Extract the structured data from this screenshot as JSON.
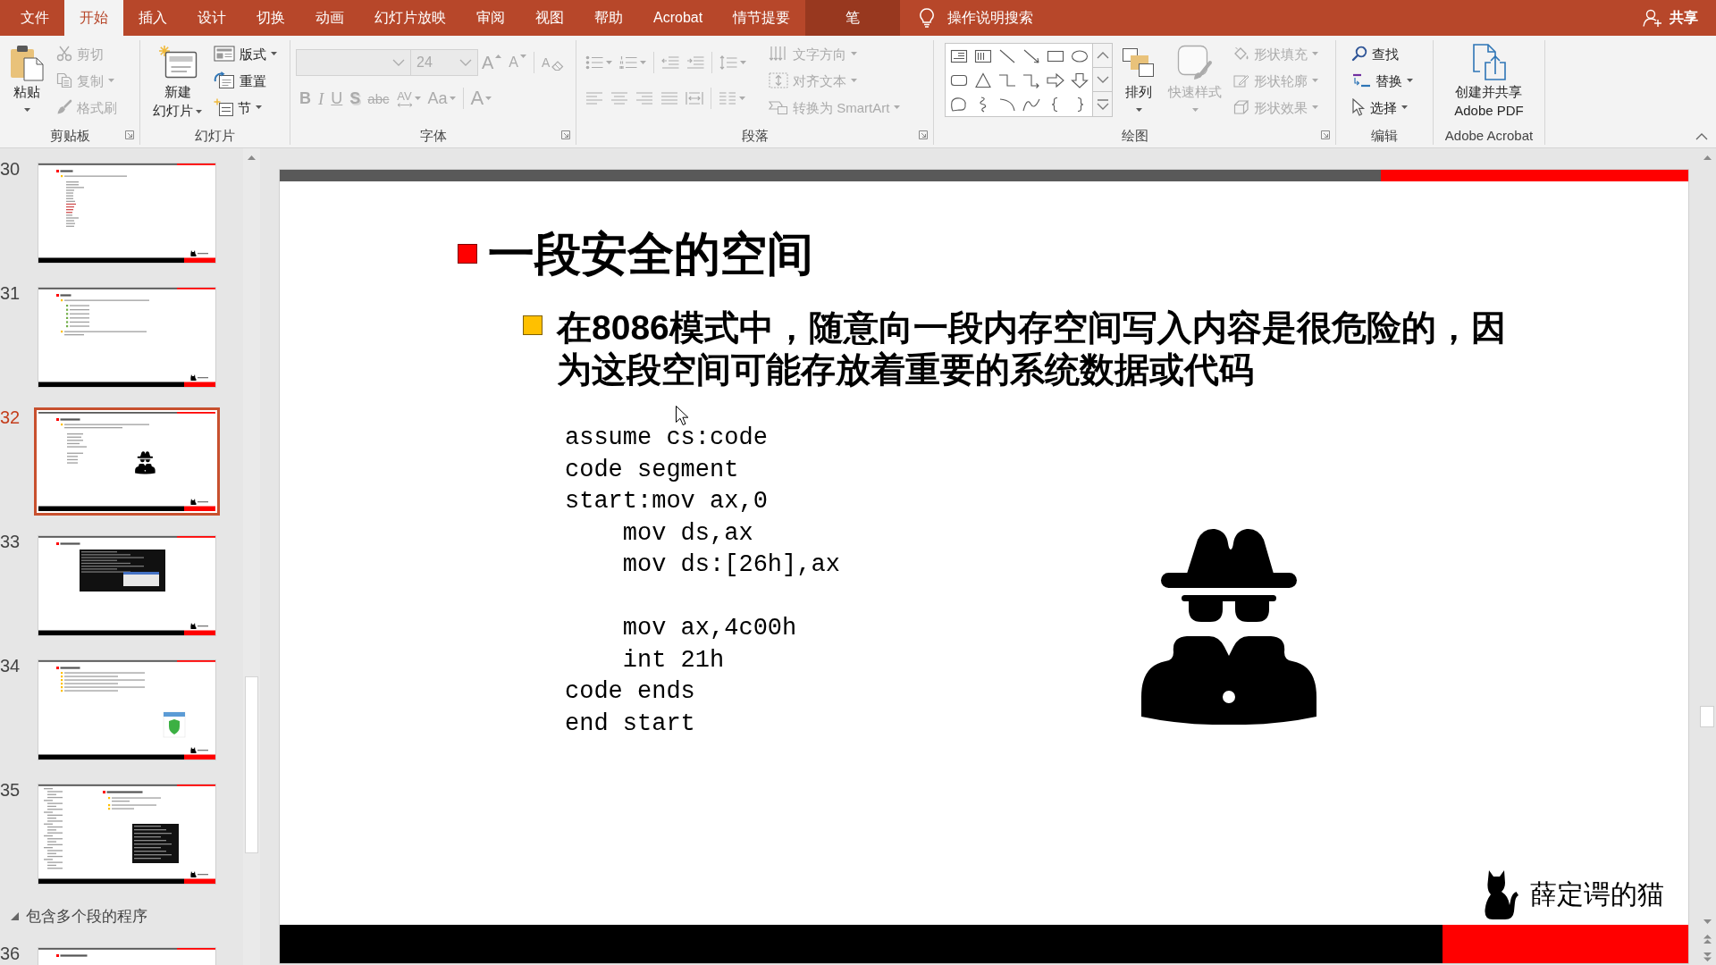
{
  "tabs": [
    {
      "label": "文件",
      "kind": "tab",
      "selected": false
    },
    {
      "label": "开始",
      "kind": "tab",
      "selected": true
    },
    {
      "label": "插入",
      "kind": "tab",
      "selected": false
    },
    {
      "label": "设计",
      "kind": "tab",
      "selected": false
    },
    {
      "label": "切换",
      "kind": "tab",
      "selected": false
    },
    {
      "label": "动画",
      "kind": "tab",
      "selected": false
    },
    {
      "label": "幻灯片放映",
      "kind": "tab",
      "selected": false
    },
    {
      "label": "审阅",
      "kind": "tab",
      "selected": false
    },
    {
      "label": "视图",
      "kind": "tab",
      "selected": false
    },
    {
      "label": "帮助",
      "kind": "tab",
      "selected": false
    },
    {
      "label": "Acrobat",
      "kind": "tab",
      "selected": false
    },
    {
      "label": "情节提要",
      "kind": "tab",
      "selected": false
    },
    {
      "label": "笔",
      "kind": "contextual",
      "selected": false
    }
  ],
  "tell_me": {
    "placeholder": "操作说明搜索"
  },
  "share": {
    "label": "共享"
  },
  "ribbon": {
    "groups": [
      {
        "label": "剪贴板",
        "launcher": true,
        "items": [
          {
            "kind": "large",
            "lines": [
              "粘贴"
            ],
            "dropdown": true,
            "disabled": false
          },
          {
            "kind": "stack",
            "items": [
              {
                "label": "剪切",
                "dropdown": false,
                "disabled": true
              },
              {
                "label": "复制",
                "dropdown": true,
                "disabled": true
              },
              {
                "label": "格式刷",
                "dropdown": false,
                "disabled": true
              }
            ]
          }
        ]
      },
      {
        "label": "幻灯片",
        "launcher": false,
        "items": [
          {
            "kind": "large",
            "lines": [
              "新建",
              "幻灯片"
            ],
            "dropdown": true,
            "disabled": false
          },
          {
            "kind": "stack",
            "items": [
              {
                "label": "版式",
                "dropdown": true,
                "disabled": false
              },
              {
                "label": "重置",
                "dropdown": false,
                "disabled": false
              },
              {
                "label": "节",
                "dropdown": true,
                "disabled": false
              }
            ]
          }
        ]
      },
      {
        "label": "字体",
        "launcher": true,
        "items": [
          {
            "kind": "rows",
            "rows": [
              [
                {
                  "kind": "fontbox",
                  "disabled": true
                },
                {
                  "kind": "sizebox",
                  "value": "24",
                  "disabled": true
                },
                {
                  "kind": "grow",
                  "label": "A",
                  "dropdown": false,
                  "disabled": true
                },
                {
                  "kind": "shrink",
                  "label": "A",
                  "dropdown": false,
                  "disabled": true
                },
                {
                  "kind": "separator"
                },
                {
                  "kind": "clear",
                  "label": "A",
                  "dropdown": false,
                  "disabled": true
                }
              ],
              [
                {
                  "kind": "bold",
                  "label": "B",
                  "dropdown": false,
                  "disabled": true
                },
                {
                  "kind": "italic",
                  "label": "I",
                  "dropdown": false,
                  "disabled": true
                },
                {
                  "kind": "underline",
                  "label": "U",
                  "dropdown": false,
                  "disabled": true
                },
                {
                  "kind": "shadow",
                  "label": "S",
                  "dropdown": false,
                  "disabled": true
                },
                {
                  "kind": "strike",
                  "label": "abc",
                  "dropdown": false,
                  "disabled": true
                },
                {
                  "kind": "spacing",
                  "label": "AV",
                  "dropdown": true,
                  "disabled": true
                },
                {
                  "kind": "case",
                  "label": "Aa",
                  "dropdown": true,
                  "disabled": true
                },
                {
                  "kind": "separator"
                },
                {
                  "kind": "color",
                  "label": "A",
                  "dropdown": true,
                  "disabled": true
                }
              ]
            ]
          }
        ]
      },
      {
        "label": "段落",
        "launcher": true,
        "items": [
          {
            "kind": "rows",
            "rows": [
              [
                {
                  "kind": "icon",
                  "dropdown": true,
                  "disabled": true
                },
                {
                  "kind": "icon",
                  "dropdown": true,
                  "disabled": true
                },
                {
                  "kind": "separator"
                },
                {
                  "kind": "icon",
                  "dropdown": false,
                  "disabled": true
                },
                {
                  "kind": "icon",
                  "dropdown": false,
                  "disabled": true
                },
                {
                  "kind": "separator"
                },
                {
                  "kind": "icon",
                  "dropdown": true,
                  "disabled": true
                }
              ],
              [
                {
                  "kind": "icon",
                  "dropdown": false,
                  "disabled": true
                },
                {
                  "kind": "icon",
                  "dropdown": false,
                  "disabled": true
                },
                {
                  "kind": "icon",
                  "dropdown": false,
                  "disabled": true
                },
                {
                  "kind": "icon",
                  "dropdown": false,
                  "disabled": true
                },
                {
                  "kind": "icon",
                  "dropdown": false,
                  "disabled": true
                },
                {
                  "kind": "separator"
                },
                {
                  "kind": "icon",
                  "dropdown": true,
                  "disabled": true
                }
              ]
            ]
          },
          {
            "kind": "stack",
            "items": [
              {
                "label": "文字方向",
                "dropdown": true,
                "disabled": true
              },
              {
                "label": "对齐文本",
                "dropdown": true,
                "disabled": true
              },
              {
                "label": "转换为 SmartArt",
                "dropdown": true,
                "disabled": true
              }
            ]
          }
        ]
      },
      {
        "label": "绘图",
        "launcher": true,
        "items": [
          {
            "kind": "gallery"
          },
          {
            "kind": "large",
            "lines": [
              "排列"
            ],
            "dropdown": true,
            "disabled": false
          },
          {
            "kind": "large",
            "lines": [
              "快速样式"
            ],
            "dropdown": true,
            "disabled": true
          },
          {
            "kind": "stack",
            "items": [
              {
                "label": "形状填充",
                "dropdown": true,
                "disabled": true
              },
              {
                "label": "形状轮廓",
                "dropdown": true,
                "disabled": true
              },
              {
                "label": "形状效果",
                "dropdown": true,
                "disabled": true
              }
            ]
          }
        ]
      },
      {
        "label": "编辑",
        "launcher": false,
        "items": [
          {
            "kind": "stack",
            "items": [
              {
                "label": "查找",
                "dropdown": false,
                "disabled": false
              },
              {
                "label": "替换",
                "dropdown": true,
                "disabled": false
              },
              {
                "label": "选择",
                "dropdown": true,
                "disabled": false
              }
            ]
          }
        ]
      },
      {
        "label": "Adobe Acrobat",
        "launcher": false,
        "items": [
          {
            "kind": "large",
            "lines": [
              "创建并共享",
              "Adobe PDF"
            ],
            "dropdown": false,
            "disabled": false
          }
        ]
      }
    ]
  },
  "slide_panel": {
    "items": [
      {
        "kind": "code",
        "number": "30",
        "selected": false
      },
      {
        "kind": "list",
        "number": "31",
        "selected": false
      },
      {
        "kind": "figure",
        "number": "32",
        "selected": true
      },
      {
        "kind": "terminal",
        "number": "33",
        "selected": false
      },
      {
        "kind": "shield",
        "number": "34",
        "selected": false
      },
      {
        "kind": "mixed",
        "number": "35",
        "selected": false
      },
      {
        "kind": "section",
        "label": "包含多个段的程序",
        "expanded": true
      },
      {
        "kind": "title",
        "number": "36",
        "selected": false
      }
    ]
  },
  "slide": {
    "title": "一段安全的空间",
    "bullets": [
      "在8086模式中，随意向一段内存空间写入内容是很危险的，因为这段空间可能存放着重要的系统数据或代码"
    ],
    "code_blocks": [
      [
        "assume cs:code",
        "code segment",
        "start:mov ax,0",
        "    mov ds,ax",
        "    mov ds:[26h],ax"
      ],
      [
        "    mov ax,4c00h",
        "    int 21h",
        "code ends",
        "end start"
      ]
    ],
    "logo": {
      "text": "薛定谔的猫"
    }
  }
}
